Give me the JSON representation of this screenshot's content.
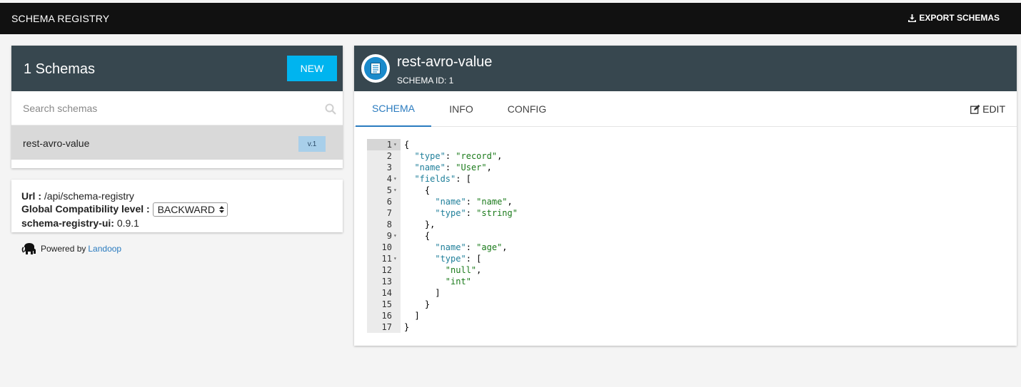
{
  "topbar": {
    "title": "SCHEMA REGISTRY",
    "export_label": "EXPORT SCHEMAS",
    "export_icon": "download-icon"
  },
  "schemas_panel": {
    "count_title": "1 Schemas",
    "new_label": "NEW",
    "search_placeholder": "Search schemas",
    "items": [
      {
        "name": "rest-avro-value",
        "version": "v.1"
      }
    ]
  },
  "info": {
    "url_label": "Url :",
    "url_value": "/api/schema-registry",
    "compat_label": "Global Compatibility level :",
    "compat_value": "BACKWARD",
    "ui_label": "schema-registry-ui:",
    "ui_version": "0.9.1"
  },
  "powered": {
    "text": "Powered by",
    "link": "Landoop"
  },
  "schema_detail": {
    "title": "rest-avro-value",
    "schema_id": "SCHEMA ID: 1",
    "tabs": [
      "SCHEMA",
      "INFO",
      "CONFIG"
    ],
    "active_tab": "SCHEMA",
    "edit_label": "EDIT",
    "code_lines": [
      {
        "n": "1",
        "fold": true,
        "text": "{"
      },
      {
        "n": "2",
        "fold": false,
        "text": "  \"type\": \"record\","
      },
      {
        "n": "3",
        "fold": false,
        "text": "  \"name\": \"User\","
      },
      {
        "n": "4",
        "fold": true,
        "text": "  \"fields\": ["
      },
      {
        "n": "5",
        "fold": true,
        "text": "    {"
      },
      {
        "n": "6",
        "fold": false,
        "text": "      \"name\": \"name\","
      },
      {
        "n": "7",
        "fold": false,
        "text": "      \"type\": \"string\""
      },
      {
        "n": "8",
        "fold": false,
        "text": "    },"
      },
      {
        "n": "9",
        "fold": true,
        "text": "    {"
      },
      {
        "n": "10",
        "fold": false,
        "text": "      \"name\": \"age\","
      },
      {
        "n": "11",
        "fold": true,
        "text": "      \"type\": ["
      },
      {
        "n": "12",
        "fold": false,
        "text": "        \"null\","
      },
      {
        "n": "13",
        "fold": false,
        "text": "        \"int\""
      },
      {
        "n": "14",
        "fold": false,
        "text": "      ]"
      },
      {
        "n": "15",
        "fold": false,
        "text": "    }"
      },
      {
        "n": "16",
        "fold": false,
        "text": "  ]"
      },
      {
        "n": "17",
        "fold": false,
        "text": "}"
      }
    ]
  },
  "colors": {
    "header_bg": "#37474f",
    "accent": "#00b4ef",
    "link": "#2a7bbf"
  }
}
